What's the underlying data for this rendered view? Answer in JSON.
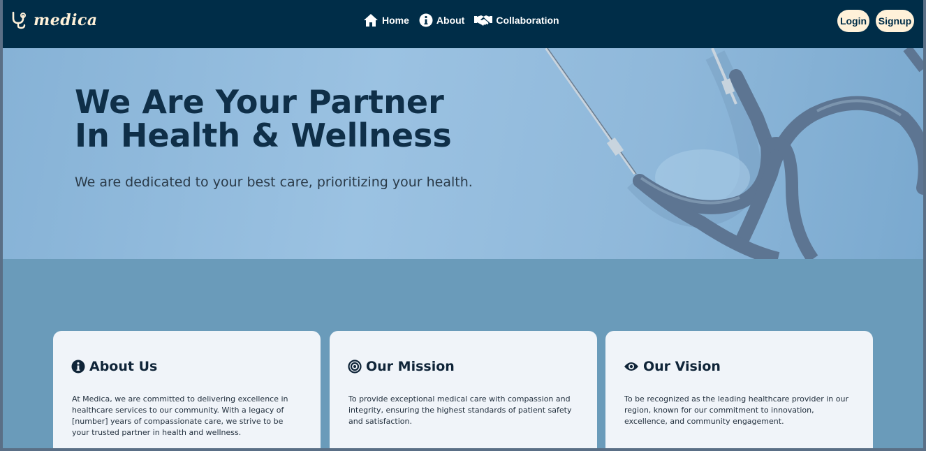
{
  "brand": {
    "name": "medica",
    "icon": "stethoscope-icon",
    "color": "#fff1d9"
  },
  "nav": {
    "links": [
      {
        "label": "Home",
        "icon": "home-icon"
      },
      {
        "label": "About",
        "icon": "info-icon"
      },
      {
        "label": "Collaboration",
        "icon": "handshake-icon"
      }
    ],
    "login_label": "Login",
    "signup_label": "Signup"
  },
  "hero": {
    "title_line1": "We Are Your Partner",
    "title_line2": "In Health & Wellness",
    "subtitle": "We are dedicated to your best care, prioritizing your health."
  },
  "cards": [
    {
      "title": "About Us",
      "icon": "info-circle-icon",
      "text": "At Medica, we are committed to delivering excellence in healthcare services to our community. With a legacy of [number] years of compassionate care, we strive to be your trusted partner in health and wellness."
    },
    {
      "title": "Our Mission",
      "icon": "target-icon",
      "text": "To provide exceptional medical care with compassion and integrity, ensuring the highest standards of patient safety and satisfaction."
    },
    {
      "title": "Our Vision",
      "icon": "eye-icon",
      "text": "To be recognized as the leading healthcare provider in our region, known for our commitment to innovation, excellence, and community engagement."
    }
  ],
  "colors": {
    "navbar": "#002d48",
    "accent": "#fff1d9",
    "section_bg": "#6a9bba",
    "card_bg": "#f0f4f9",
    "hero_title": "#0f2f48"
  }
}
